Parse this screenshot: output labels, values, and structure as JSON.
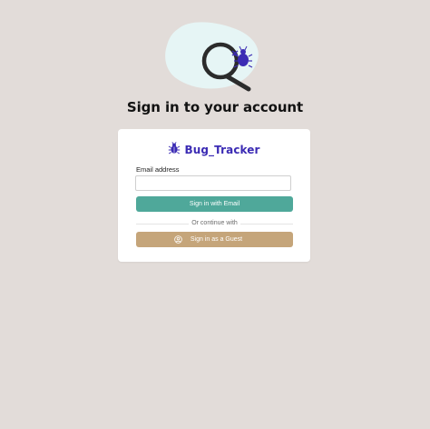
{
  "page": {
    "title": "Sign in to your account"
  },
  "brand": {
    "name": "Bug_Tracker",
    "icon": "bug-icon",
    "color": "#3b2bb4"
  },
  "hero": {
    "icon": "magnifier-bug-illustration"
  },
  "form": {
    "email_label": "Email address",
    "email_value": "",
    "email_placeholder": "",
    "email_button": "Sign in with Email",
    "divider_text": "Or continue with",
    "guest_button": "Sign in as a Guest",
    "guest_icon": "user-circle-icon"
  },
  "colors": {
    "background": "#e2dcd9",
    "email_button": "#4fa89a",
    "guest_button": "#c5a57a",
    "hero_blob": "#e6f5f5"
  }
}
